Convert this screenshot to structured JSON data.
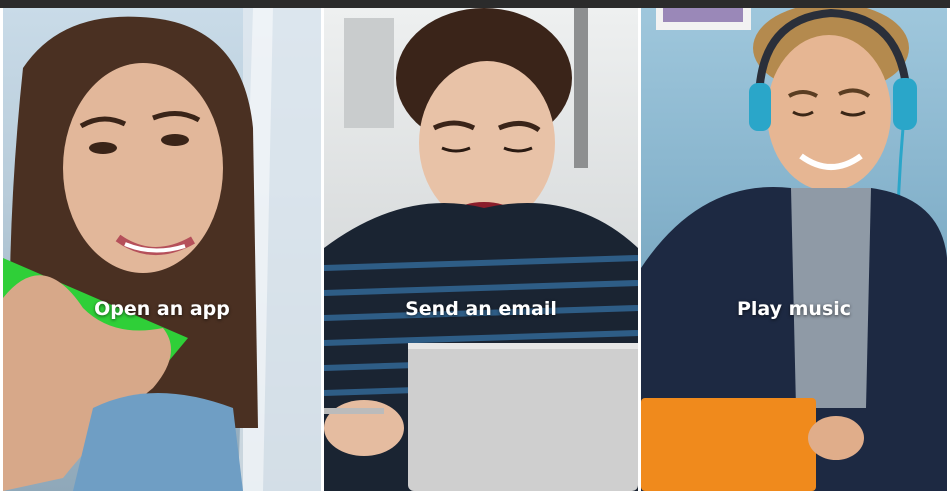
{
  "colors": {
    "top_bar": "#2b2b2b",
    "label_text": "#ffffff",
    "phone_green": "#2fcf38",
    "laptop_orange": "#f08a1c",
    "laptop_silver": "#cfcfcf",
    "headphone_blue": "#2aa6c9"
  },
  "tiles": [
    {
      "label": "Open an app",
      "image": "woman-holding-green-phone-photo"
    },
    {
      "label": "Send an email",
      "image": "woman-typing-on-laptop-photo"
    },
    {
      "label": "Play music",
      "image": "man-with-headphones-photo"
    }
  ]
}
